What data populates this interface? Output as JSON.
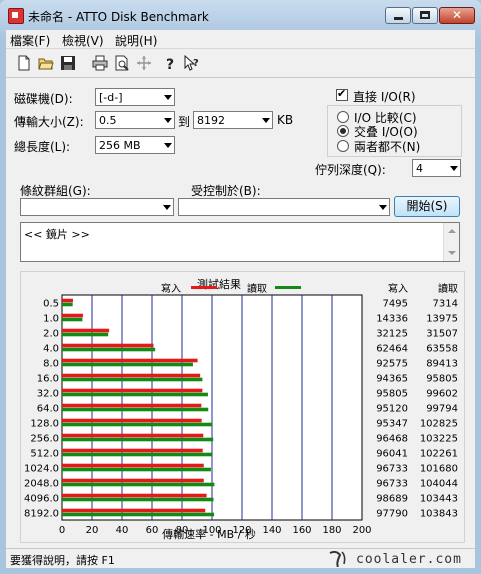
{
  "window": {
    "title": "未命名 - ATTO Disk Benchmark"
  },
  "menu": [
    "檔案(F)",
    "檢視(V)",
    "說明(H)"
  ],
  "toolbar_icons": [
    "new-file-icon",
    "open-folder-icon",
    "save-icon",
    "print-icon",
    "print-preview-icon",
    "move-icon",
    "help-icon",
    "context-help-icon"
  ],
  "form": {
    "drive_label": "磁碟機(D):",
    "drive_value": "[-d-]",
    "transfer_label": "傳輸大小(Z):",
    "transfer_from": "0.5",
    "to_label": "到",
    "transfer_to": "8192",
    "unit": "KB",
    "length_label": "總長度(L):",
    "length_value": "256 MB",
    "direct_io_label": "直接 I/O(R)",
    "direct_io_checked": true,
    "radio_io_compare": "I/O 比較(C)",
    "radio_overlap": "交叠 I/O(O)",
    "radio_neither": "兩者都不(N)",
    "radio_selected": "overlap",
    "queue_label": "佇列深度(Q):",
    "queue_value": "4",
    "pattern_label": "條紋群組(G):",
    "pattern_value": "",
    "controlled_label": "受控制於(B):",
    "controlled_value": "",
    "start_button": "開始(S)",
    "notes": "<< 鏡片 >>"
  },
  "chart_data": {
    "type": "bar",
    "orientation": "horizontal",
    "title": "測試結果",
    "xlabel": "傳輸速率 - MB / 秒",
    "xlim": [
      0,
      200
    ],
    "xticks": [
      0,
      20,
      40,
      60,
      80,
      100,
      120,
      140,
      160,
      180,
      200
    ],
    "grid": true,
    "legend_position": "top",
    "categories": [
      "0.5",
      "1.0",
      "2.0",
      "4.0",
      "8.0",
      "16.0",
      "32.0",
      "64.0",
      "128.0",
      "256.0",
      "512.0",
      "1024.0",
      "2048.0",
      "4096.0",
      "8192.0"
    ],
    "series": [
      {
        "name": "寫入",
        "color": "#e41a1a",
        "values": [
          7.3,
          14.0,
          31.4,
          61.0,
          90.4,
          92.1,
          93.6,
          92.9,
          93.1,
          94.2,
          93.8,
          94.5,
          94.5,
          96.4,
          95.5
        ]
      },
      {
        "name": "讀取",
        "color": "#138a13",
        "values": [
          7.1,
          13.6,
          30.8,
          62.1,
          87.3,
          93.6,
          97.3,
          97.5,
          100.4,
          100.8,
          99.9,
          99.3,
          101.6,
          101.0,
          101.4
        ]
      }
    ],
    "table_headers": [
      "寫入",
      "讀取"
    ],
    "table": [
      [
        "7495",
        "7314"
      ],
      [
        "14336",
        "13975"
      ],
      [
        "32125",
        "31507"
      ],
      [
        "62464",
        "63558"
      ],
      [
        "92575",
        "89413"
      ],
      [
        "94365",
        "95805"
      ],
      [
        "95805",
        "99602"
      ],
      [
        "95120",
        "99794"
      ],
      [
        "95347",
        "102825"
      ],
      [
        "96468",
        "103225"
      ],
      [
        "96041",
        "102261"
      ],
      [
        "96733",
        "101680"
      ],
      [
        "96733",
        "104044"
      ],
      [
        "98689",
        "103443"
      ],
      [
        "97790",
        "103843"
      ]
    ]
  },
  "status": {
    "text": "要獲得說明，請按 F1",
    "watermark": "coolaler.com"
  }
}
